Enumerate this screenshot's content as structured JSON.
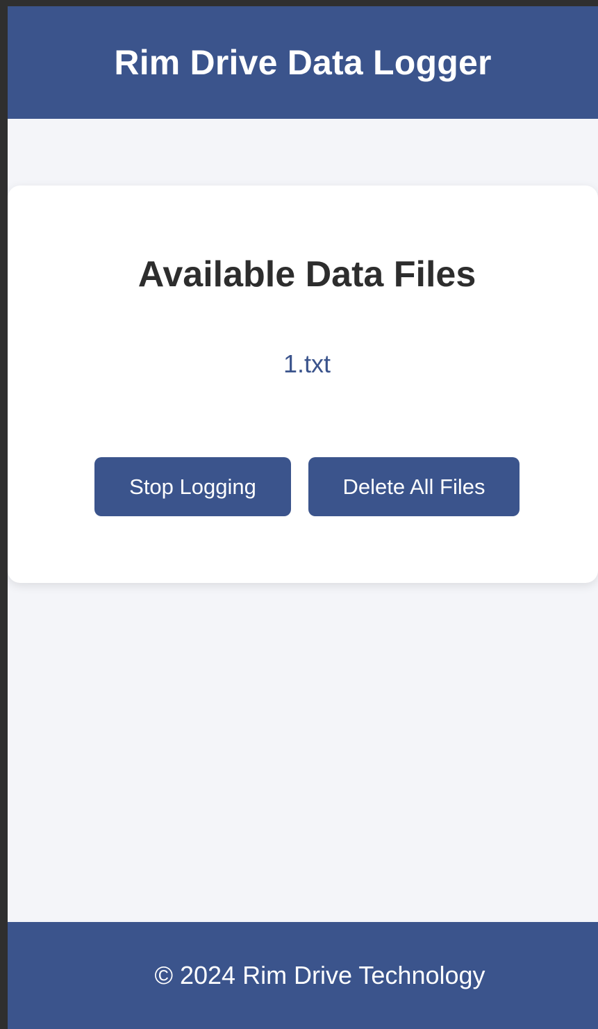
{
  "header": {
    "title": "Rim Drive Data Logger"
  },
  "files_panel": {
    "title": "Available Data Files",
    "files": [
      "1.txt"
    ]
  },
  "actions": {
    "stop_label": "Stop Logging",
    "delete_label": "Delete All Files"
  },
  "footer": {
    "text": "© 2024 Rim Drive Technology"
  },
  "colors": {
    "primary": "#3b548c",
    "background": "#f4f5f9",
    "card": "#ffffff",
    "heading_text": "#2d2d2d"
  }
}
